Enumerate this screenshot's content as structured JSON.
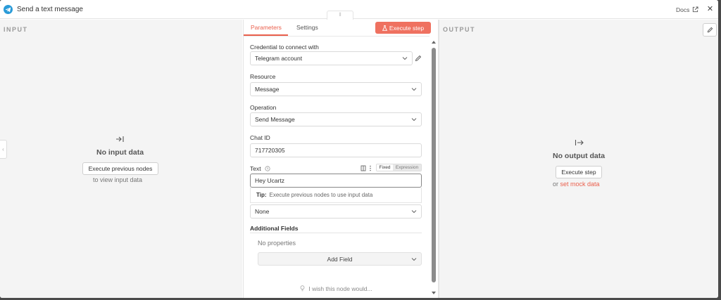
{
  "header": {
    "title": "Send a text message",
    "docs_label": "Docs",
    "close_glyph": "✕"
  },
  "input_panel": {
    "label": "INPUT",
    "empty_title": "No input data",
    "execute_button": "Execute previous nodes",
    "hint": "to view input data",
    "icon": "arrow-into-bar-icon"
  },
  "output_panel": {
    "label": "OUTPUT",
    "empty_title": "No output data",
    "execute_button": "Execute step",
    "or_text": "or",
    "mock_link": "set mock data",
    "icon": "arrow-out-bar-icon"
  },
  "params": {
    "tabs": [
      {
        "label": "Parameters",
        "active": true
      },
      {
        "label": "Settings",
        "active": false
      }
    ],
    "execute_step_label": "Execute step",
    "credential": {
      "label": "Credential to connect with",
      "value": "Telegram account"
    },
    "resource": {
      "label": "Resource",
      "value": "Message"
    },
    "operation": {
      "label": "Operation",
      "value": "Send Message"
    },
    "chat_id": {
      "label": "Chat ID",
      "value": "717720305"
    },
    "text": {
      "label": "Text",
      "value": "Hey Ucartz",
      "mode_fixed": "Fixed",
      "mode_expression": "Expression"
    },
    "tip": {
      "prefix": "Tip:",
      "body": "Execute previous nodes to use input data"
    },
    "parse_mode_value": "None",
    "additional_fields": {
      "title": "Additional Fields",
      "empty": "No properties",
      "add_label": "Add Field"
    },
    "feedback": "I wish this node would..."
  },
  "colors": {
    "accent": "#ea5f4c",
    "telegram": "#2a9bd8"
  }
}
